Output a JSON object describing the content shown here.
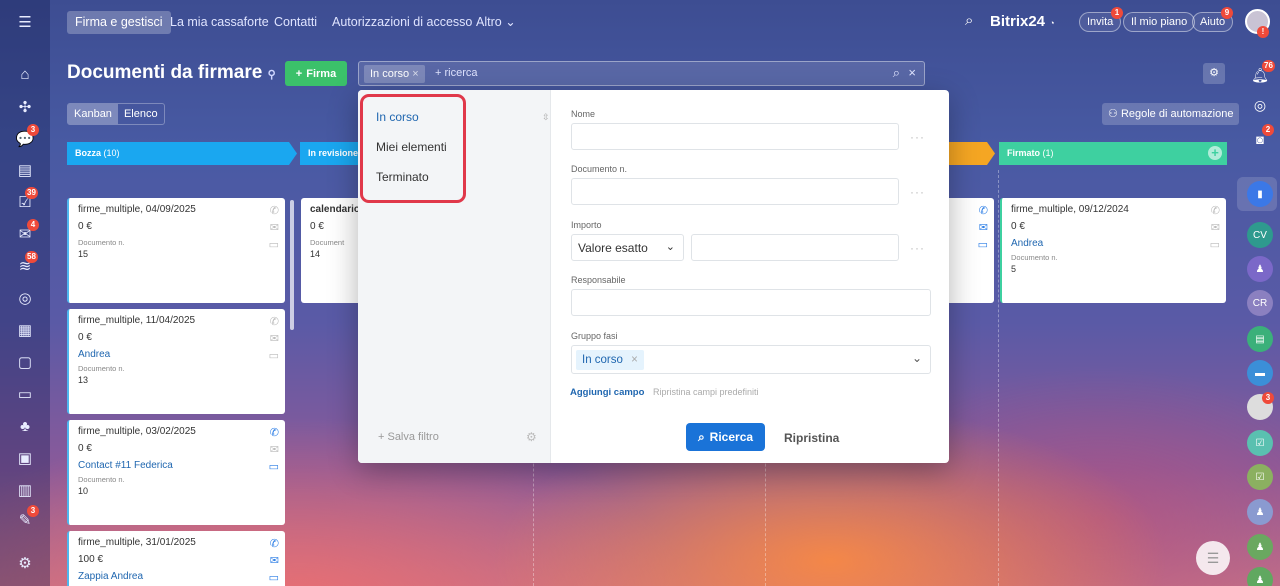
{
  "topnav": {
    "items": [
      "Firma e gestisci",
      "La mia cassaforte",
      "Contatti",
      "Autorizzazioni di accesso",
      "Altro"
    ],
    "more_caret": "⌄"
  },
  "header": {
    "brand": "Bitrix",
    "brand_num": "24",
    "invite": "Invita",
    "invite_badge": "1",
    "plan": "Il mio piano",
    "help": "Aiuto",
    "help_badge": "9",
    "avatar_badge": "!"
  },
  "leftbar": {
    "badges": [
      "3",
      "39",
      "4",
      "58",
      "3"
    ]
  },
  "page": {
    "title": "Documenti da firmare",
    "add_label": "Firma",
    "view": {
      "kanban": "Kanban",
      "list": "Elenco"
    },
    "automation": "Regole di automazione"
  },
  "search": {
    "chip": "In corso",
    "placeholder": "+ ricerca"
  },
  "columns": [
    {
      "name": "Bozza",
      "count": "(10)",
      "color": "#1aa7f0"
    },
    {
      "name": "In revisione",
      "count": "",
      "color": "#1aa7f0"
    },
    {
      "name": "Firmato",
      "count": "(1)",
      "color": "#3ed0a0"
    }
  ],
  "cards_col1": [
    {
      "title": "firme_multiple, 04/09/2025",
      "value": "0 €",
      "link": "",
      "sub": "Documento n.",
      "num": "15"
    },
    {
      "title": "firme_multiple, 11/04/2025",
      "value": "0 €",
      "link": "Andrea",
      "sub": "Documento n.",
      "num": "13"
    },
    {
      "title": "firme_multiple, 03/02/2025",
      "value": "0 €",
      "link": "Contact #11 Federica",
      "sub": "Documento n.",
      "num": "10"
    },
    {
      "title": "firme_multiple, 31/01/2025",
      "value": "100 €",
      "link": "Zappia Andrea",
      "sub": "",
      "num": ""
    }
  ],
  "card_col2": {
    "title": "calendario",
    "value": "0 €",
    "sub": "Document",
    "num": "14"
  },
  "card_firmato": {
    "title": "firme_multiple, 09/12/2024",
    "value": "0 €",
    "link": "Andrea",
    "sub": "Documento n.",
    "num": "5"
  },
  "filter": {
    "presets": [
      "In corso",
      "Miei elementi",
      "Terminato"
    ],
    "save_filter": "+ Salva filtro",
    "fields": {
      "name": "Nome",
      "doc_num": "Documento n.",
      "amount": "Importo",
      "amount_mode": "Valore esatto",
      "responsible": "Responsabile",
      "stage_group": "Gruppo fasi",
      "stage_chip": "In corso"
    },
    "add_field": "Aggiungi campo",
    "restore_fields": "Ripristina campi predefiniti",
    "search_btn": "Ricerca",
    "reset_btn": "Ripristina"
  },
  "rightbar": {
    "notif_badge": "76",
    "chat_badge": "2",
    "cv": "CV",
    "cr": "CR",
    "avatar_badge": "3"
  }
}
